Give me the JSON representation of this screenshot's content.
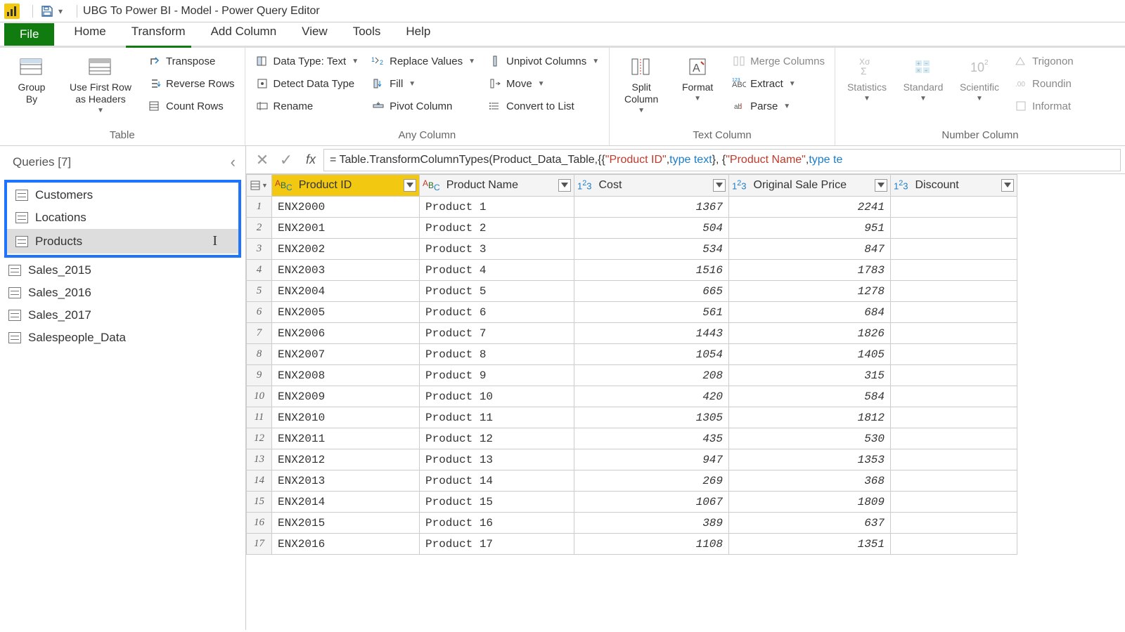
{
  "title": "UBG To Power BI - Model - Power Query Editor",
  "menu": {
    "file": "File",
    "home": "Home",
    "transform": "Transform",
    "addcol": "Add Column",
    "view": "View",
    "tools": "Tools",
    "help": "Help"
  },
  "ribbon": {
    "table": {
      "label": "Table",
      "groupby": "Group\nBy",
      "firstrow": "Use First Row\nas Headers",
      "transpose": "Transpose",
      "reverse": "Reverse Rows",
      "count": "Count Rows"
    },
    "anycol": {
      "label": "Any Column",
      "datatype": "Data Type: Text",
      "detect": "Detect Data Type",
      "rename": "Rename",
      "replace": "Replace Values",
      "fill": "Fill",
      "pivot": "Pivot Column",
      "unpivot": "Unpivot Columns",
      "move": "Move",
      "tolist": "Convert to List"
    },
    "textcol": {
      "label": "Text Column",
      "split": "Split\nColumn",
      "format": "Format",
      "merge": "Merge Columns",
      "extract": "Extract",
      "parse": "Parse"
    },
    "numcol": {
      "label": "Number Column",
      "stats": "Statistics",
      "standard": "Standard",
      "scientific": "Scientific",
      "trig": "Trigonon",
      "round": "Roundin",
      "info": "Informat"
    }
  },
  "queries": {
    "header": "Queries [7]",
    "items": [
      "Customers",
      "Locations",
      "Products",
      "Sales_2015",
      "Sales_2016",
      "Sales_2017",
      "Salespeople_Data"
    ],
    "selected": "Products"
  },
  "formula": {
    "prefix": "= Table.TransformColumnTypes(Product_Data_Table,{{",
    "s1": "\"Product ID\"",
    "mid1": ", ",
    "kw1": "type text",
    "mid2": "}, {",
    "s2": "\"Product Name\"",
    "mid3": ", ",
    "kw2": "type te"
  },
  "columns": [
    {
      "name": "Product ID",
      "type": "text",
      "selected": true,
      "w": "w-pid"
    },
    {
      "name": "Product Name",
      "type": "text",
      "selected": false,
      "w": "w-pname"
    },
    {
      "name": "Cost",
      "type": "num",
      "selected": false,
      "w": "w-cost"
    },
    {
      "name": "Original Sale Price",
      "type": "num",
      "selected": false,
      "w": "w-osp"
    },
    {
      "name": "Discount",
      "type": "num",
      "selected": false,
      "w": "w-disc"
    }
  ],
  "rows": [
    [
      "ENX2000",
      "Product 1",
      "1367",
      "2241",
      ""
    ],
    [
      "ENX2001",
      "Product 2",
      "504",
      "951",
      ""
    ],
    [
      "ENX2002",
      "Product 3",
      "534",
      "847",
      ""
    ],
    [
      "ENX2003",
      "Product 4",
      "1516",
      "1783",
      ""
    ],
    [
      "ENX2004",
      "Product 5",
      "665",
      "1278",
      ""
    ],
    [
      "ENX2005",
      "Product 6",
      "561",
      "684",
      ""
    ],
    [
      "ENX2006",
      "Product 7",
      "1443",
      "1826",
      ""
    ],
    [
      "ENX2007",
      "Product 8",
      "1054",
      "1405",
      ""
    ],
    [
      "ENX2008",
      "Product 9",
      "208",
      "315",
      ""
    ],
    [
      "ENX2009",
      "Product 10",
      "420",
      "584",
      ""
    ],
    [
      "ENX2010",
      "Product 11",
      "1305",
      "1812",
      ""
    ],
    [
      "ENX2011",
      "Product 12",
      "435",
      "530",
      ""
    ],
    [
      "ENX2012",
      "Product 13",
      "947",
      "1353",
      ""
    ],
    [
      "ENX2013",
      "Product 14",
      "269",
      "368",
      ""
    ],
    [
      "ENX2014",
      "Product 15",
      "1067",
      "1809",
      ""
    ],
    [
      "ENX2015",
      "Product 16",
      "389",
      "637",
      ""
    ],
    [
      "ENX2016",
      "Product 17",
      "1108",
      "1351",
      ""
    ]
  ]
}
